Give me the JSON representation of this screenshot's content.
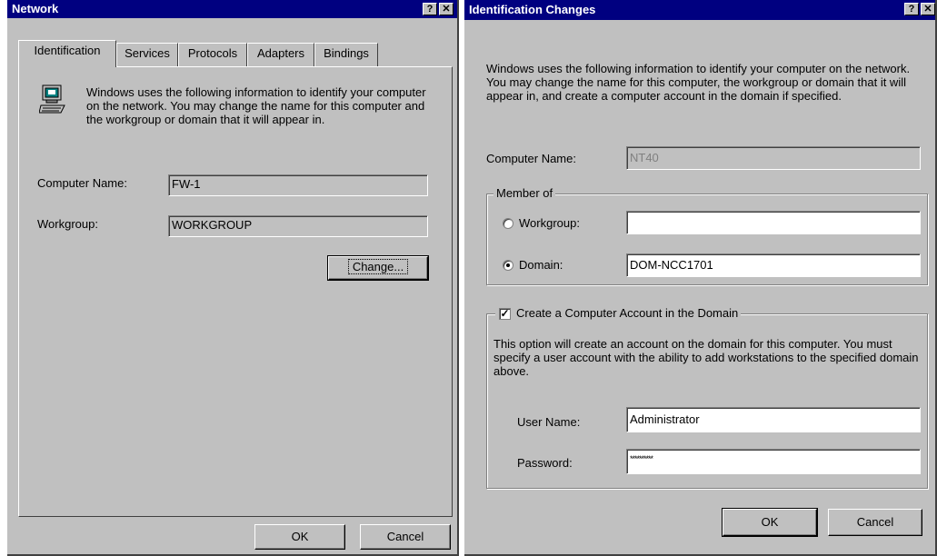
{
  "network": {
    "title": "Network",
    "help_glyph": "?",
    "close_glyph": "✕",
    "tabs": [
      "Identification",
      "Services",
      "Protocols",
      "Adapters",
      "Bindings"
    ],
    "description": "Windows uses the following information to identify your computer on the network.  You may change the name for this computer and the workgroup or domain that it will appear in.",
    "computer_name_label": "Computer Name:",
    "computer_name_value": "FW-1",
    "workgroup_label": "Workgroup:",
    "workgroup_value": "WORKGROUP",
    "change_button": "Change...",
    "ok_button": "OK",
    "cancel_button": "Cancel"
  },
  "ident_changes": {
    "title": "Identification Changes",
    "help_glyph": "?",
    "close_glyph": "✕",
    "description": "Windows uses the following information to identify your computer on the network.  You may change the name for this computer, the workgroup or domain that it will appear in, and create a computer account in the domain if specified.",
    "computer_name_label": "Computer Name:",
    "computer_name_value": "NT40",
    "member_of_label": "Member of",
    "workgroup_label": "Workgroup:",
    "workgroup_value": "",
    "domain_label": "Domain:",
    "domain_value": "DOM-NCC1701",
    "selected_member": "domain",
    "create_account_label": "Create a Computer Account in the Domain",
    "create_account_checked": true,
    "account_description": "This option will create an account on the domain for this computer.  You must specify a user account with the ability to add workstations to the specified domain above.",
    "user_name_label": "User Name:",
    "user_name_value": "Administrator",
    "password_label": "Password:",
    "password_value": "**********",
    "ok_button": "OK",
    "cancel_button": "Cancel"
  },
  "colors": {
    "title_bar": "#000080",
    "face": "#c0c0c0"
  }
}
